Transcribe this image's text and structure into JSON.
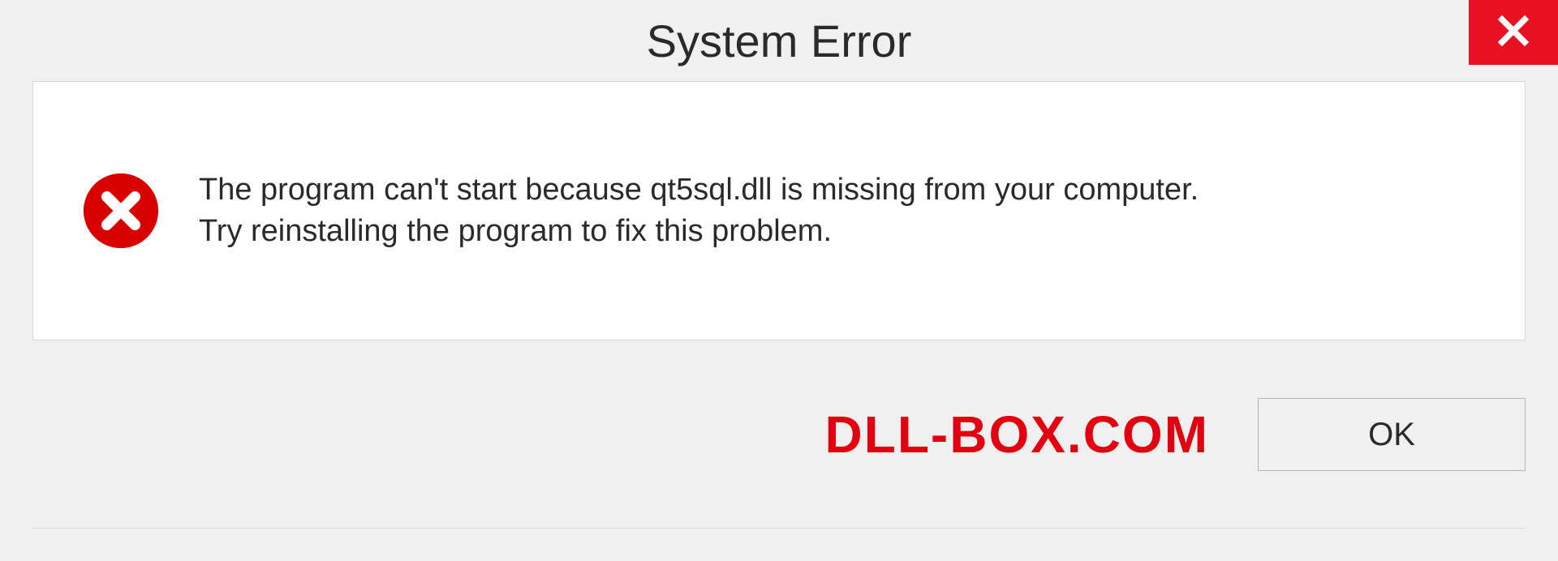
{
  "dialog": {
    "title": "System Error",
    "message_line1": "The program can't start because qt5sql.dll is missing from your computer.",
    "message_line2": "Try reinstalling the program to fix this problem.",
    "ok_label": "OK"
  },
  "watermark": {
    "text": "DLL-BOX.COM"
  },
  "colors": {
    "accent_red": "#e20010",
    "close_red": "#e81123",
    "panel_bg": "#ffffff",
    "page_bg": "#f0f0f0"
  }
}
